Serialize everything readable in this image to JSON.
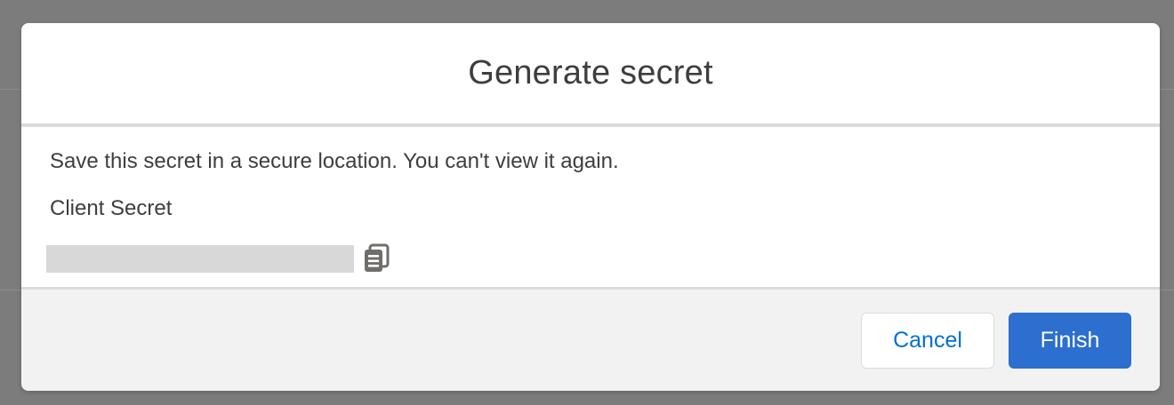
{
  "modal": {
    "title": "Generate secret",
    "message": "Save this secret in a secure location. You can't view it again.",
    "field_label": "Client Secret",
    "secret_value": "",
    "copy_icon": "copy-icon"
  },
  "footer": {
    "cancel_label": "Cancel",
    "finish_label": "Finish"
  },
  "colors": {
    "backdrop": "#7c7c7c",
    "primary_button": "#2c6fce",
    "link_blue": "#0070d2",
    "footer_bg": "#f3f2f2",
    "divider": "#dddbda",
    "redacted": "#d8d8d8"
  }
}
